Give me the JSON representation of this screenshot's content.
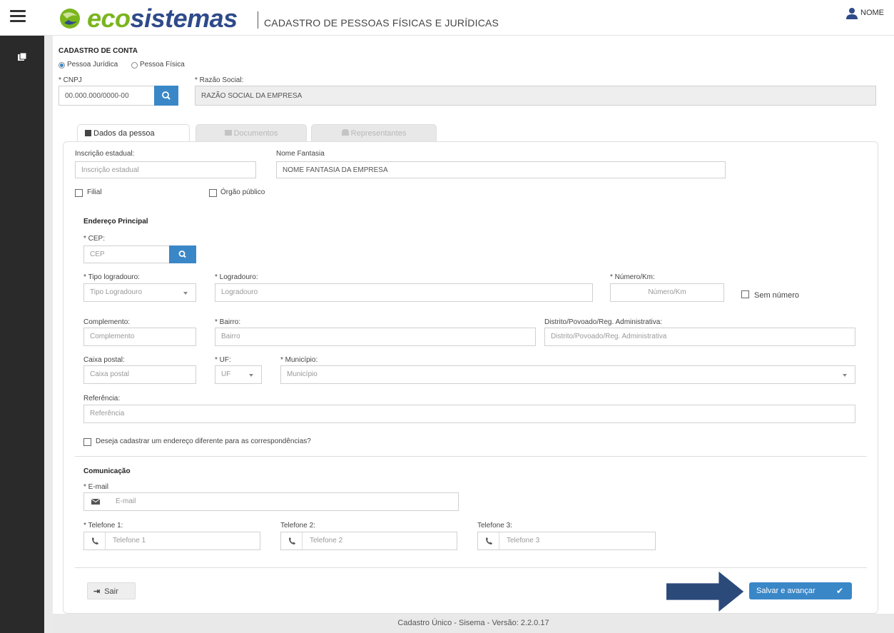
{
  "header": {
    "logo_eco": "eco",
    "logo_sis": "sistemas",
    "subtitle": "CADASTRO DE PESSOAS FÍSICAS E JURÍDICAS",
    "user": "NOME"
  },
  "account": {
    "title": "CADASTRO DE CONTA",
    "radio_juridica": "Pessoa Jurídica",
    "radio_fisica": "Pessoa Física",
    "cnpj_label": "* CNPJ",
    "cnpj_value": "00.000.000/0000-00",
    "razao_label": "* Razão Social:",
    "razao_value": "RAZÃO SOCIAL DA EMPRESA"
  },
  "tabs": [
    "Dados da pessoa",
    "Documentos",
    "Representantes"
  ],
  "pessoa": {
    "ie_label": "Inscrição estadual:",
    "ie_placeholder": "Inscrição estadual",
    "fantasia_label": "Nome Fantasia",
    "fantasia_value": "NOME FANTASIA DA EMPRESA",
    "filial": "Filial",
    "orgao": "Órgão público"
  },
  "endereco": {
    "title": "Endereço Principal",
    "cep_label": "* CEP:",
    "cep_placeholder": "CEP",
    "tipo_label": "* Tipo logradouro:",
    "tipo_placeholder": "Tipo Logradouro",
    "logradouro_label": "* Logradouro:",
    "logradouro_placeholder": "Logradouro",
    "numero_label": "* Número/Km:",
    "numero_placeholder": "Número/Km",
    "sem_numero": "Sem número",
    "complemento_label": "Complemento:",
    "complemento_placeholder": "Complemento",
    "bairro_label": "* Bairro:",
    "bairro_placeholder": "Bairro",
    "distrito_label": "Distrito/Povoado/Reg. Administrativa:",
    "distrito_placeholder": "Distrito/Povoado/Reg. Administrativa",
    "caixa_label": "Caixa postal:",
    "caixa_placeholder": "Caixa postal",
    "uf_label": "* UF:",
    "uf_placeholder": "UF",
    "municipio_label": "* Município:",
    "municipio_placeholder": "Município",
    "referencia_label": "Referência:",
    "referencia_placeholder": "Referência",
    "correspondencia": "Deseja cadastrar um endereço diferente para as correspondências?"
  },
  "comunicacao": {
    "title": "Comunicação",
    "email_label": "* E-mail",
    "email_placeholder": "E-mail",
    "tel1_label": "* Telefone 1:",
    "tel1_placeholder": "Telefone 1",
    "tel2_label": "Telefone 2:",
    "tel2_placeholder": "Telefone 2",
    "tel3_label": "Telefone 3:",
    "tel3_placeholder": "Telefone 3"
  },
  "actions": {
    "sair": "Sair",
    "salvar": "Salvar e avançar"
  },
  "footer": "Cadastro Único - Sisema - Versão: 2.2.0.17",
  "colors": {
    "accent": "#3a87c8",
    "arrow": "#2b4a7a",
    "eco": "#7ab51d",
    "brand": "#2e4a8a"
  }
}
